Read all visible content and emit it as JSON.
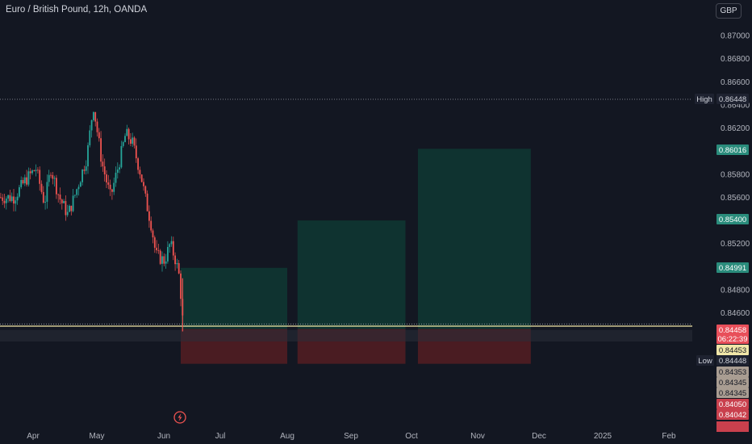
{
  "header": {
    "title": "Euro / British Pound, 12h, OANDA",
    "currency_label": "GBP"
  },
  "colors": {
    "background": "#131722",
    "up": "#26a69a",
    "down": "#ef5350",
    "profit_zone": "#0f3330",
    "loss_zone": "#4a1c22",
    "price_line": "#f5e9a8",
    "text": "#d1d4dc"
  },
  "icons": {
    "bottom_marker": "lightning-icon"
  },
  "chart_data": {
    "type": "candlestick",
    "ylim": [
      0.84,
      0.871
    ],
    "y_ticks": [
      "0.87000",
      "0.86800",
      "0.86600",
      "0.86400",
      "0.86200",
      "0.85800",
      "0.85600",
      "0.85200",
      "0.84800",
      "0.84600"
    ],
    "x_ticks": [
      "Apr",
      "May",
      "Jun",
      "Jul",
      "Aug",
      "Sep",
      "Oct",
      "Nov",
      "Dec",
      "2025",
      "Feb"
    ],
    "high_label": "High",
    "high": "0.86448",
    "low_label": "Low",
    "low": "0.84448",
    "price_tags": [
      {
        "value": "0.86016",
        "kind": "profit"
      },
      {
        "value": "0.85400",
        "kind": "profit"
      },
      {
        "value": "0.84991",
        "kind": "profit"
      },
      {
        "value": "0.84458",
        "kind": "current"
      },
      {
        "value": "06:22:39",
        "kind": "countdown"
      },
      {
        "value": "0.84453",
        "kind": "price"
      },
      {
        "value": "0.84353",
        "kind": "stop"
      },
      {
        "value": "0.84345",
        "kind": "stop"
      },
      {
        "value": "0.84345",
        "kind": "stop"
      },
      {
        "value": "0.84050",
        "kind": "loss"
      },
      {
        "value": "0.84042",
        "kind": "loss"
      }
    ],
    "positions": [
      {
        "start": "Jun 10",
        "end": "Aug 1",
        "entry": 0.8446,
        "target": 0.8499,
        "stop": 0.8416
      },
      {
        "start": "Aug 6",
        "end": "Sep 28",
        "entry": 0.8446,
        "target": 0.854,
        "stop": 0.8416
      },
      {
        "start": "Oct 4",
        "end": "Nov 27",
        "entry": 0.8446,
        "target": 0.8602,
        "stop": 0.8416
      }
    ],
    "ohlc_anchors": [
      {
        "date": "Mar 20",
        "price": 0.856
      },
      {
        "date": "Mar 27",
        "price": 0.8575
      },
      {
        "date": "Apr 2",
        "price": 0.8585
      },
      {
        "date": "Apr 6",
        "price": 0.8555
      },
      {
        "date": "Apr 9",
        "price": 0.8585
      },
      {
        "date": "Apr 13",
        "price": 0.856
      },
      {
        "date": "Apr 17",
        "price": 0.8545
      },
      {
        "date": "Apr 20",
        "price": 0.856
      },
      {
        "date": "Apr 26",
        "price": 0.8595
      },
      {
        "date": "Apr 29",
        "price": 0.864
      },
      {
        "date": "May 3",
        "price": 0.859
      },
      {
        "date": "May 7",
        "price": 0.856
      },
      {
        "date": "May 11",
        "price": 0.859
      },
      {
        "date": "May 14",
        "price": 0.8615
      },
      {
        "date": "May 17",
        "price": 0.8608
      },
      {
        "date": "May 21",
        "price": 0.858
      },
      {
        "date": "May 23",
        "price": 0.856
      },
      {
        "date": "May 26",
        "price": 0.8535
      },
      {
        "date": "May 28",
        "price": 0.851
      },
      {
        "date": "Jun 1",
        "price": 0.8505
      },
      {
        "date": "Jun 4",
        "price": 0.852
      },
      {
        "date": "Jun 7",
        "price": 0.8505
      },
      {
        "date": "Jun 9",
        "price": 0.849
      },
      {
        "date": "Jun 11",
        "price": 0.8446
      }
    ]
  }
}
